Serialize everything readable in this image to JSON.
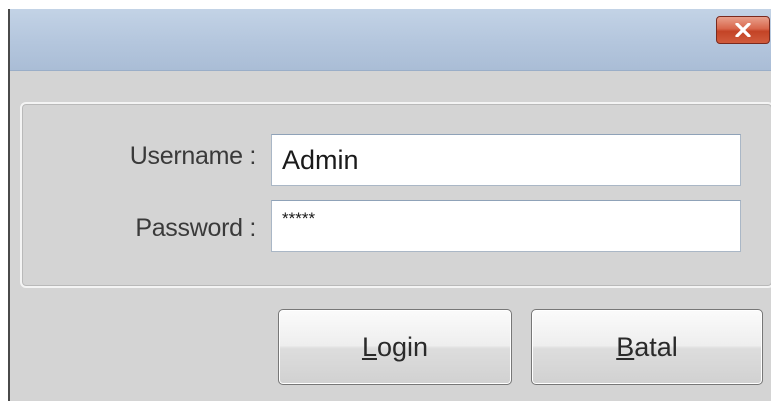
{
  "window": {
    "close_icon": "close-icon",
    "close_color": "#c34326"
  },
  "form": {
    "username_label": "Username :",
    "username_value": "Admin",
    "password_label": "Password :",
    "password_value": "*****"
  },
  "buttons": {
    "login_mnemonic": "L",
    "login_rest": "ogin",
    "batal_mnemonic": "B",
    "batal_rest": "atal"
  }
}
